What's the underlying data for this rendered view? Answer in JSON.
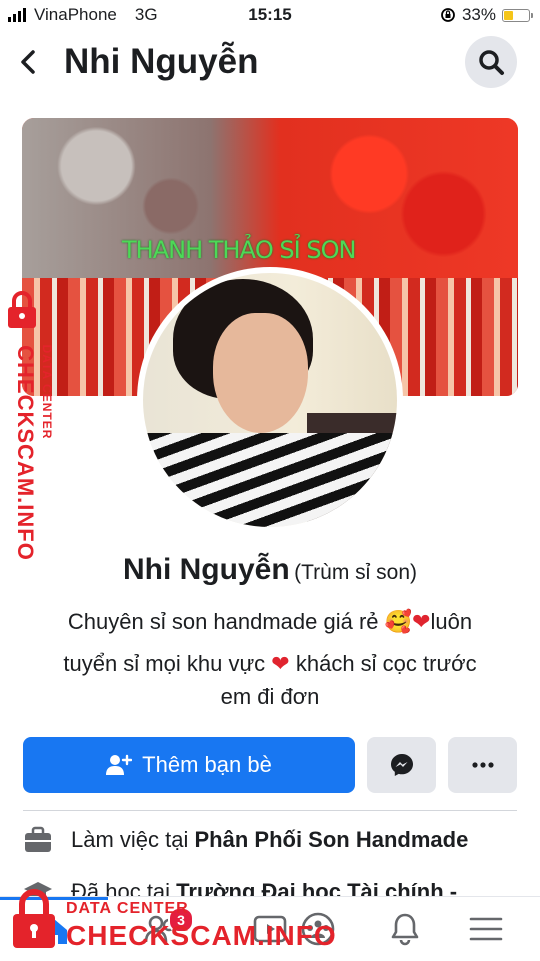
{
  "status_bar": {
    "carrier": "VinaPhone",
    "network": "3G",
    "time": "15:15",
    "battery": "33%",
    "battery_level": 0.33
  },
  "header": {
    "title": "Nhi Nguyễn"
  },
  "cover": {
    "text": "THANH THẢO SỈ SON"
  },
  "profile": {
    "name": "Nhi Nguyễn",
    "nickname": "(Trùm sỉ son)",
    "bio_lines": [
      {
        "a": "Chuyên sỉ son handmade giá rẻ ",
        "emoji": "🥰",
        "heart": "❤",
        "b": "luôn"
      },
      {
        "a": "tuyển sỉ mọi khu vực ",
        "heart": "❤",
        "b": " khách sỉ cọc trước"
      },
      {
        "a": "em đi đơn"
      }
    ]
  },
  "actions": {
    "add_friend": "Thêm bạn bè"
  },
  "info": {
    "work_prefix": "Làm việc tại ",
    "work_place": "Phân Phối Son Handmade",
    "study_prefix": "Đã học tại ",
    "study_place": "Trường Đại học Tài chính -"
  },
  "tab_bar": {
    "friend_badge": "3"
  },
  "watermark": {
    "side_big": "CHECKSCAM.INFO",
    "side_small": "DATA CENTER",
    "bottom_small": "DATA CENTER",
    "bottom_big": "CHECKSCAM.INFO"
  },
  "colors": {
    "primary": "#1877f2",
    "watermark": "#e4232b",
    "battery": "#f5c518"
  }
}
